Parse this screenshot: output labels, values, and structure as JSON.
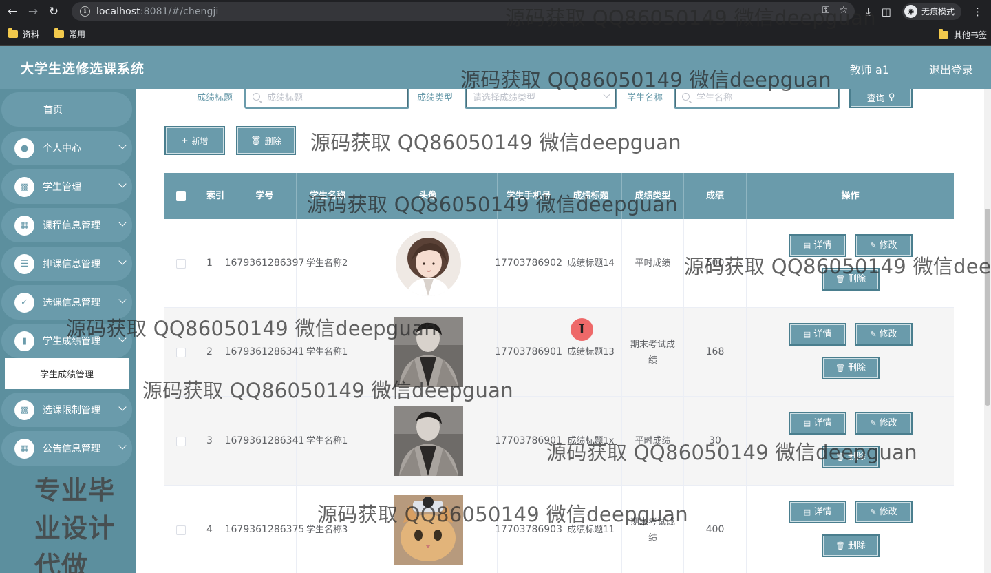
{
  "browser": {
    "url_host": "localhost",
    "url_rest": ":8081/#/chengji",
    "incognito_label": "无痕模式",
    "bookmarks": [
      "资料",
      "常用"
    ],
    "bookmarks_right": "其他书签"
  },
  "header": {
    "title": "大学生选修选课系统",
    "user": "教师 a1",
    "logout": "退出登录"
  },
  "sidebar": {
    "home": "首页",
    "items": [
      {
        "label": "个人中心",
        "icon": "user-icon"
      },
      {
        "label": "学生管理",
        "icon": "id-card-icon"
      },
      {
        "label": "课程信息管理",
        "icon": "grid-icon"
      },
      {
        "label": "排课信息管理",
        "icon": "list-icon"
      },
      {
        "label": "选课信息管理",
        "icon": "check-doc-icon"
      },
      {
        "label": "学生成绩管理",
        "icon": "bar-chart-icon"
      },
      {
        "label": "选课限制管理",
        "icon": "monitor-icon"
      },
      {
        "label": "公告信息管理",
        "icon": "grid-icon"
      }
    ],
    "sub_item": "学生成绩管理",
    "promo": "专业毕业设计代做"
  },
  "search": {
    "title_label": "成绩标题",
    "title_placeholder": "成绩标题",
    "type_label": "成绩类型",
    "type_placeholder": "请选择成绩类型",
    "name_label": "学生名称",
    "name_placeholder": "学生名称",
    "query_button": "查询"
  },
  "actions": {
    "add": "新增",
    "delete": "删除"
  },
  "table": {
    "headers": [
      "索引",
      "学号",
      "学生名称",
      "头像",
      "学生手机号",
      "成绩标题",
      "成绩类型",
      "成绩",
      "操作"
    ],
    "rows": [
      {
        "index": "1",
        "student_no": "1679361286397",
        "name": "学生名称2",
        "avatar": "girl-illustration",
        "phone": "17703786902",
        "score_title": "成绩标题14",
        "score_type": "平时成绩",
        "score": "500"
      },
      {
        "index": "2",
        "student_no": "1679361286341",
        "name": "学生名称1",
        "avatar": "man-photo",
        "phone": "17703786901",
        "score_title": "成绩标题13",
        "score_type": "期末考试成绩",
        "score": "168"
      },
      {
        "index": "3",
        "student_no": "1679361286341",
        "name": "学生名称1",
        "avatar": "man-photo",
        "phone": "17703786901",
        "score_title": "成绩标题1x",
        "score_type": "平时成绩",
        "score": "30"
      },
      {
        "index": "4",
        "student_no": "1679361286375",
        "name": "学生名称3",
        "avatar": "cat-photo",
        "phone": "17703786903",
        "score_title": "成绩标题11",
        "score_type": "期末考试成绩",
        "score": "400"
      }
    ],
    "op_detail": "详情",
    "op_edit": "修改",
    "op_delete": "删除"
  },
  "watermark": "源码获取 QQ86050149 微信deepguan",
  "colors": {
    "primary": "#6a9bab",
    "sidebar_bg": "#5c8f9e",
    "chrome_bg": "#202124"
  }
}
